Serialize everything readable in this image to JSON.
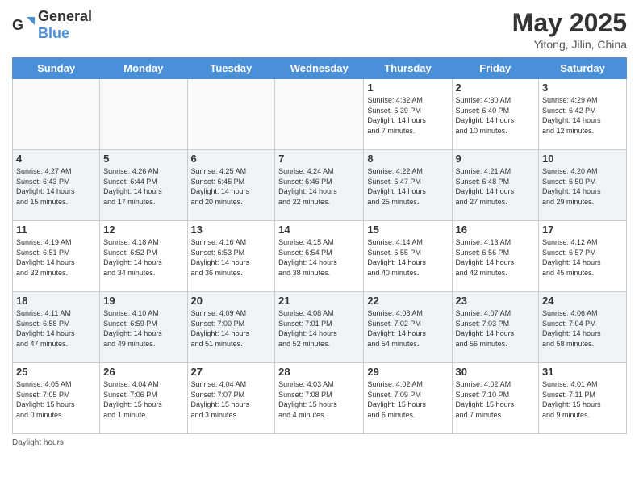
{
  "header": {
    "logo_general": "General",
    "logo_blue": "Blue",
    "month_year": "May 2025",
    "location": "Yitong, Jilin, China"
  },
  "weekdays": [
    "Sunday",
    "Monday",
    "Tuesday",
    "Wednesday",
    "Thursday",
    "Friday",
    "Saturday"
  ],
  "footer": {
    "daylight_label": "Daylight hours"
  },
  "weeks": [
    [
      {
        "day": "",
        "info": ""
      },
      {
        "day": "",
        "info": ""
      },
      {
        "day": "",
        "info": ""
      },
      {
        "day": "",
        "info": ""
      },
      {
        "day": "1",
        "info": "Sunrise: 4:32 AM\nSunset: 6:39 PM\nDaylight: 14 hours\nand 7 minutes."
      },
      {
        "day": "2",
        "info": "Sunrise: 4:30 AM\nSunset: 6:40 PM\nDaylight: 14 hours\nand 10 minutes."
      },
      {
        "day": "3",
        "info": "Sunrise: 4:29 AM\nSunset: 6:42 PM\nDaylight: 14 hours\nand 12 minutes."
      }
    ],
    [
      {
        "day": "4",
        "info": "Sunrise: 4:27 AM\nSunset: 6:43 PM\nDaylight: 14 hours\nand 15 minutes."
      },
      {
        "day": "5",
        "info": "Sunrise: 4:26 AM\nSunset: 6:44 PM\nDaylight: 14 hours\nand 17 minutes."
      },
      {
        "day": "6",
        "info": "Sunrise: 4:25 AM\nSunset: 6:45 PM\nDaylight: 14 hours\nand 20 minutes."
      },
      {
        "day": "7",
        "info": "Sunrise: 4:24 AM\nSunset: 6:46 PM\nDaylight: 14 hours\nand 22 minutes."
      },
      {
        "day": "8",
        "info": "Sunrise: 4:22 AM\nSunset: 6:47 PM\nDaylight: 14 hours\nand 25 minutes."
      },
      {
        "day": "9",
        "info": "Sunrise: 4:21 AM\nSunset: 6:48 PM\nDaylight: 14 hours\nand 27 minutes."
      },
      {
        "day": "10",
        "info": "Sunrise: 4:20 AM\nSunset: 6:50 PM\nDaylight: 14 hours\nand 29 minutes."
      }
    ],
    [
      {
        "day": "11",
        "info": "Sunrise: 4:19 AM\nSunset: 6:51 PM\nDaylight: 14 hours\nand 32 minutes."
      },
      {
        "day": "12",
        "info": "Sunrise: 4:18 AM\nSunset: 6:52 PM\nDaylight: 14 hours\nand 34 minutes."
      },
      {
        "day": "13",
        "info": "Sunrise: 4:16 AM\nSunset: 6:53 PM\nDaylight: 14 hours\nand 36 minutes."
      },
      {
        "day": "14",
        "info": "Sunrise: 4:15 AM\nSunset: 6:54 PM\nDaylight: 14 hours\nand 38 minutes."
      },
      {
        "day": "15",
        "info": "Sunrise: 4:14 AM\nSunset: 6:55 PM\nDaylight: 14 hours\nand 40 minutes."
      },
      {
        "day": "16",
        "info": "Sunrise: 4:13 AM\nSunset: 6:56 PM\nDaylight: 14 hours\nand 42 minutes."
      },
      {
        "day": "17",
        "info": "Sunrise: 4:12 AM\nSunset: 6:57 PM\nDaylight: 14 hours\nand 45 minutes."
      }
    ],
    [
      {
        "day": "18",
        "info": "Sunrise: 4:11 AM\nSunset: 6:58 PM\nDaylight: 14 hours\nand 47 minutes."
      },
      {
        "day": "19",
        "info": "Sunrise: 4:10 AM\nSunset: 6:59 PM\nDaylight: 14 hours\nand 49 minutes."
      },
      {
        "day": "20",
        "info": "Sunrise: 4:09 AM\nSunset: 7:00 PM\nDaylight: 14 hours\nand 51 minutes."
      },
      {
        "day": "21",
        "info": "Sunrise: 4:08 AM\nSunset: 7:01 PM\nDaylight: 14 hours\nand 52 minutes."
      },
      {
        "day": "22",
        "info": "Sunrise: 4:08 AM\nSunset: 7:02 PM\nDaylight: 14 hours\nand 54 minutes."
      },
      {
        "day": "23",
        "info": "Sunrise: 4:07 AM\nSunset: 7:03 PM\nDaylight: 14 hours\nand 56 minutes."
      },
      {
        "day": "24",
        "info": "Sunrise: 4:06 AM\nSunset: 7:04 PM\nDaylight: 14 hours\nand 58 minutes."
      }
    ],
    [
      {
        "day": "25",
        "info": "Sunrise: 4:05 AM\nSunset: 7:05 PM\nDaylight: 15 hours\nand 0 minutes."
      },
      {
        "day": "26",
        "info": "Sunrise: 4:04 AM\nSunset: 7:06 PM\nDaylight: 15 hours\nand 1 minute."
      },
      {
        "day": "27",
        "info": "Sunrise: 4:04 AM\nSunset: 7:07 PM\nDaylight: 15 hours\nand 3 minutes."
      },
      {
        "day": "28",
        "info": "Sunrise: 4:03 AM\nSunset: 7:08 PM\nDaylight: 15 hours\nand 4 minutes."
      },
      {
        "day": "29",
        "info": "Sunrise: 4:02 AM\nSunset: 7:09 PM\nDaylight: 15 hours\nand 6 minutes."
      },
      {
        "day": "30",
        "info": "Sunrise: 4:02 AM\nSunset: 7:10 PM\nDaylight: 15 hours\nand 7 minutes."
      },
      {
        "day": "31",
        "info": "Sunrise: 4:01 AM\nSunset: 7:11 PM\nDaylight: 15 hours\nand 9 minutes."
      }
    ]
  ]
}
